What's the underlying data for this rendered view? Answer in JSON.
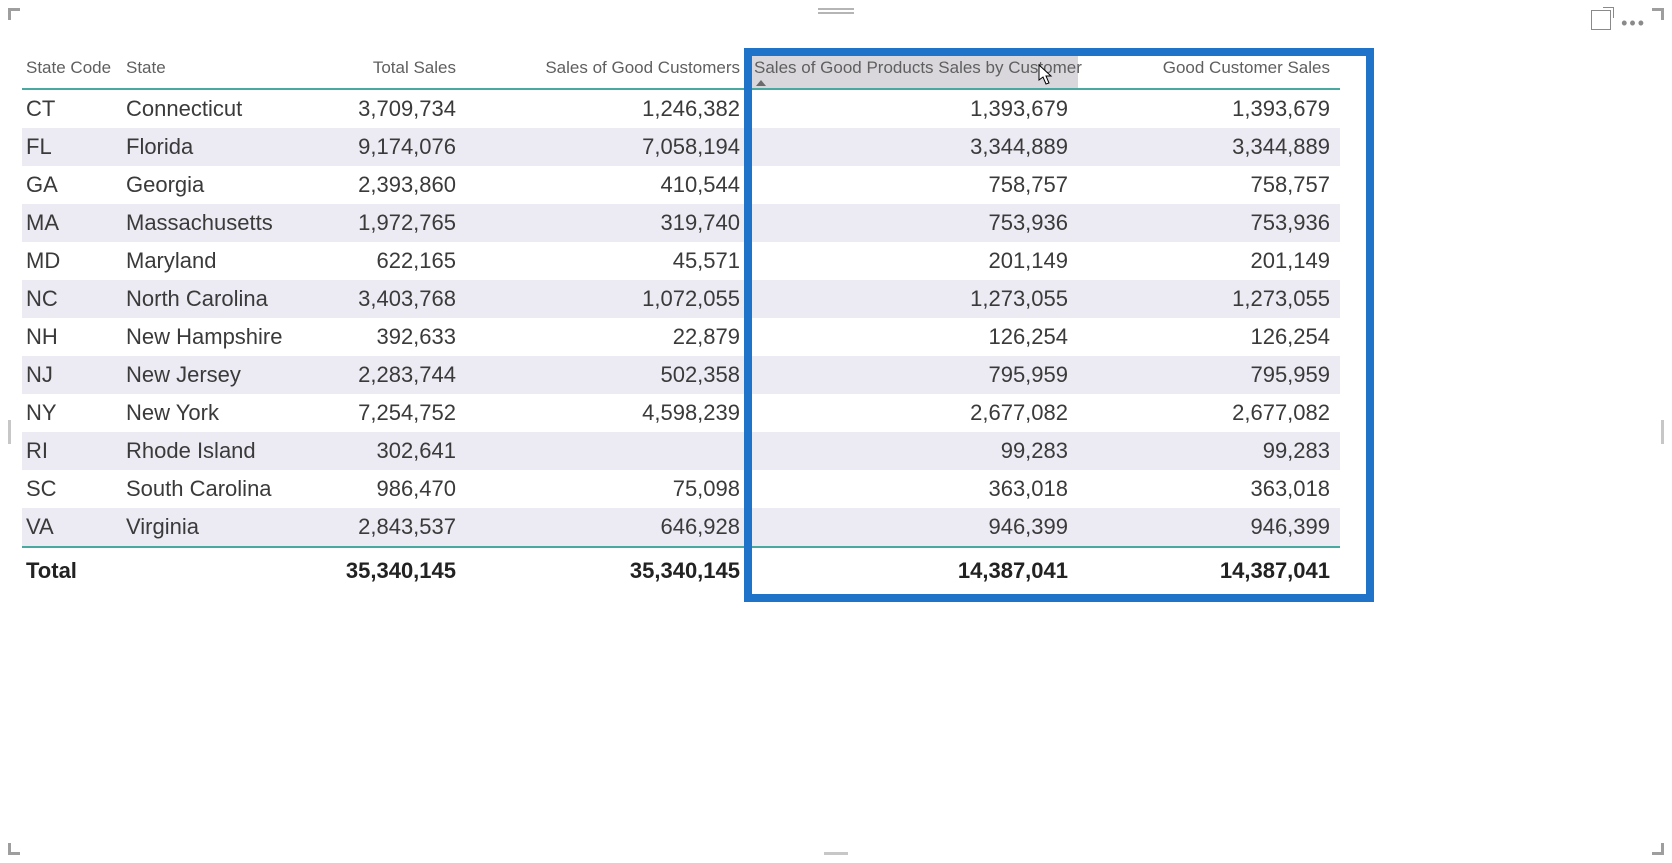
{
  "chart_data": {
    "type": "table",
    "title": "",
    "columns": [
      "State Code",
      "State",
      "Total Sales",
      "Sales of Good Customers",
      "Sales of Good Products Sales by Customer",
      "Good Customer Sales"
    ],
    "rows": [
      {
        "code": "CT",
        "state": "Connecticut",
        "total": "3,709,734",
        "goodcust": "1,246,382",
        "prodsales": "1,393,679",
        "gcsales": "1,393,679"
      },
      {
        "code": "FL",
        "state": "Florida",
        "total": "9,174,076",
        "goodcust": "7,058,194",
        "prodsales": "3,344,889",
        "gcsales": "3,344,889"
      },
      {
        "code": "GA",
        "state": "Georgia",
        "total": "2,393,860",
        "goodcust": "410,544",
        "prodsales": "758,757",
        "gcsales": "758,757"
      },
      {
        "code": "MA",
        "state": "Massachusetts",
        "total": "1,972,765",
        "goodcust": "319,740",
        "prodsales": "753,936",
        "gcsales": "753,936"
      },
      {
        "code": "MD",
        "state": "Maryland",
        "total": "622,165",
        "goodcust": "45,571",
        "prodsales": "201,149",
        "gcsales": "201,149"
      },
      {
        "code": "NC",
        "state": "North Carolina",
        "total": "3,403,768",
        "goodcust": "1,072,055",
        "prodsales": "1,273,055",
        "gcsales": "1,273,055"
      },
      {
        "code": "NH",
        "state": "New Hampshire",
        "total": "392,633",
        "goodcust": "22,879",
        "prodsales": "126,254",
        "gcsales": "126,254"
      },
      {
        "code": "NJ",
        "state": "New Jersey",
        "total": "2,283,744",
        "goodcust": "502,358",
        "prodsales": "795,959",
        "gcsales": "795,959"
      },
      {
        "code": "NY",
        "state": "New York",
        "total": "7,254,752",
        "goodcust": "4,598,239",
        "prodsales": "2,677,082",
        "gcsales": "2,677,082"
      },
      {
        "code": "RI",
        "state": "Rhode Island",
        "total": "302,641",
        "goodcust": "",
        "prodsales": "99,283",
        "gcsales": "99,283"
      },
      {
        "code": "SC",
        "state": "South Carolina",
        "total": "986,470",
        "goodcust": "75,098",
        "prodsales": "363,018",
        "gcsales": "363,018"
      },
      {
        "code": "VA",
        "state": "Virginia",
        "total": "2,843,537",
        "goodcust": "646,928",
        "prodsales": "946,399",
        "gcsales": "946,399"
      }
    ],
    "totals": {
      "label": "Total",
      "total": "35,340,145",
      "goodcust": "35,340,145",
      "prodsales": "14,387,041",
      "gcsales": "14,387,041"
    }
  },
  "headers": {
    "code": "State Code",
    "state": "State",
    "total": "Total Sales",
    "goodcust": "Sales of Good Customers",
    "prodsales": "Sales of Good Products Sales by Customer",
    "gcsales": "Good Customer Sales"
  }
}
